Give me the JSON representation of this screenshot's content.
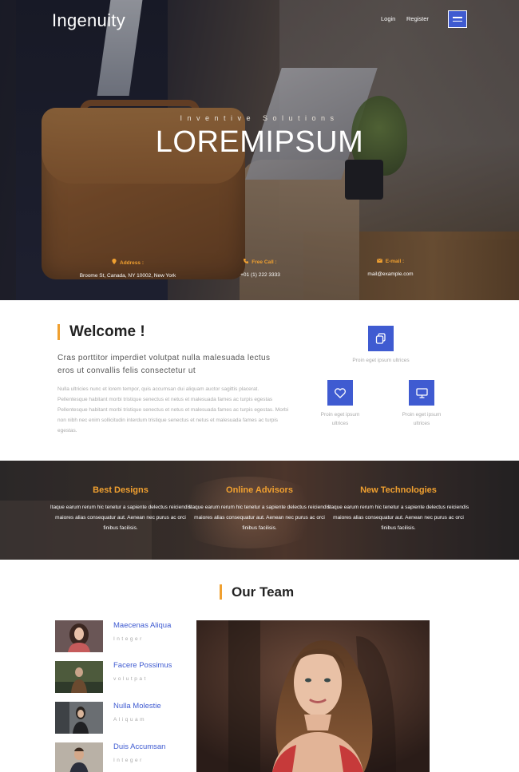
{
  "header": {
    "brand": "Ingenuity",
    "nav": [
      "Login",
      "Register"
    ],
    "menu_icon": "hamburger-icon"
  },
  "hero": {
    "subtitle": "Inventive Solutions",
    "title": "LOREMIPSUM",
    "contacts": [
      {
        "icon": "location-icon",
        "label": "Address :",
        "value": "Broome St, Canada, NY 10002, New York"
      },
      {
        "icon": "phone-icon",
        "label": "Free Call :",
        "value": "+01 (1) 222 3333"
      },
      {
        "icon": "mail-icon",
        "label": "E-mail :",
        "value": "mail@example.com"
      }
    ]
  },
  "welcome": {
    "title": "Welcome !",
    "lead": "Cras porttitor imperdiet volutpat nulla malesuada lectus eros ut convallis felis consectetur ut",
    "body": "Nulla ultricies nunc et lorem tempor, quis accumsan dui aliquam auctor sagittis placerat. Pellentesque habitant morbi tristique senectus et netus et malesuada fames ac turpis egestas Pellentesque habitant morbi tristique senectus et netus et malesuada fames ac turpis egestas. Morbi non nibh nec enim sollicitudin interdum tristique senectus et netus et malesuada fames ac turpis egestas.",
    "features": [
      {
        "icon": "copy-icon",
        "text": "Proin eget ipsum ultrices"
      },
      {
        "icon": "heart-icon",
        "text_line1": "Proin eget ipsum",
        "text_line2": "ultrices"
      },
      {
        "icon": "monitor-icon",
        "text_line1": "Proin eget ipsum",
        "text_line2": "ultrices"
      }
    ]
  },
  "services": [
    {
      "title": "Best Designs",
      "text": "Itaque earum rerum hic tenetur a sapiente delectus reiciendis maiores alias consequatur aut. Aenean nec purus ac orci finibus facilisis."
    },
    {
      "title": "Online Advisors",
      "text": "Itaque earum rerum hic tenetur a sapiente delectus reiciendis maiores alias consequatur aut. Aenean nec purus ac orci finibus facilisis."
    },
    {
      "title": "New Technologies",
      "text": "Itaque earum rerum hic tenetur a sapiente delectus reiciendis maiores alias consequatur aut. Aenean nec purus ac orci finibus facilisis."
    }
  ],
  "team": {
    "title": "Our Team",
    "members": [
      {
        "name": "Maecenas Aliqua",
        "role": "Integer"
      },
      {
        "name": "Facere Possimus",
        "role": "volutpat"
      },
      {
        "name": "Nulla Molestie",
        "role": "Aliquam"
      },
      {
        "name": "Duis Accumsan",
        "role": "Integer"
      }
    ]
  },
  "colors": {
    "accent": "#f0a030",
    "primary": "#3f5bd1"
  }
}
